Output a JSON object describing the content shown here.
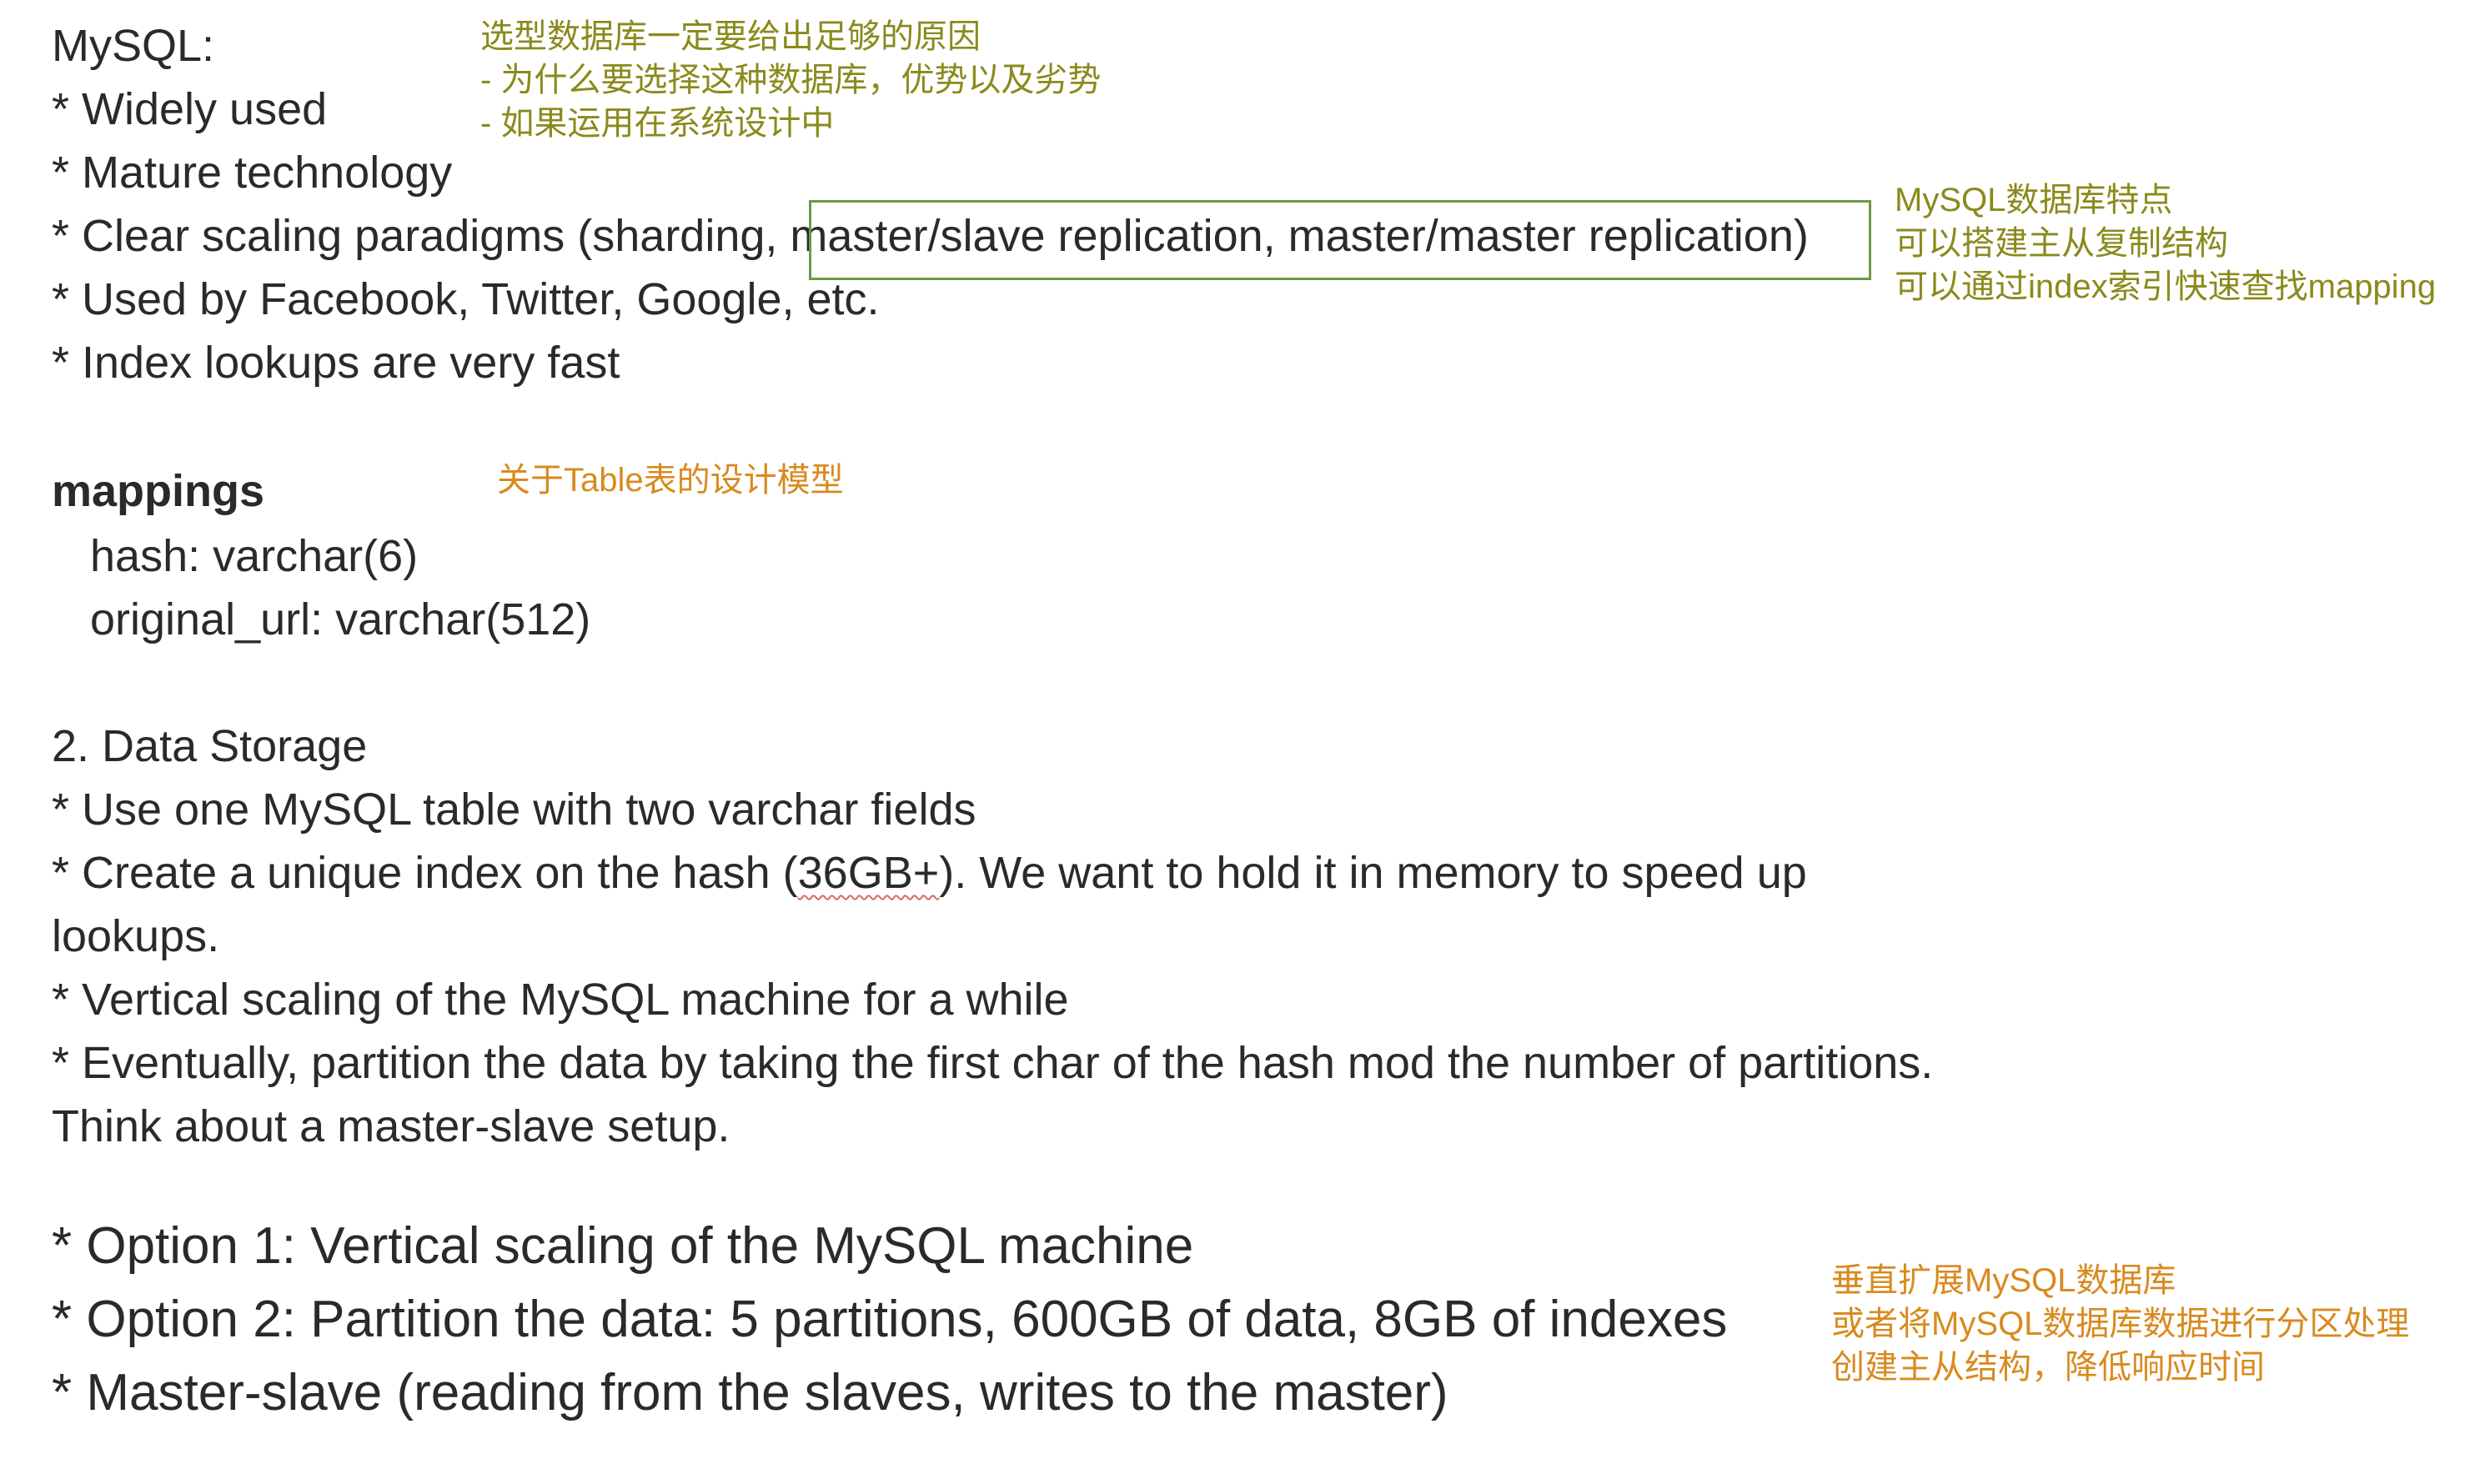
{
  "mysql": {
    "title": "MySQL:",
    "bullets": [
      "* Widely used",
      "* Mature technology",
      "* Clear scaling paradigms (sharding, ",
      "* Used by Facebook, Twitter, Google, etc.",
      "* Index lookups are very fast"
    ],
    "boxed_text": "master/slave replication, master/master replication)"
  },
  "notes": {
    "selection": [
      "选型数据库一定要给出足够的原因",
      "- 为什么要选择这种数据库，优势以及劣势",
      "- 如果运用在系统设计中"
    ],
    "mysql_features": [
      "MySQL数据库特点",
      "可以搭建主从复制结构",
      "可以通过index索引快速查找mapping"
    ],
    "table_design": "关于Table表的设计模型",
    "scaling": [
      "垂直扩展MySQL数据库",
      "或者将MySQL数据库数据进行分区处理",
      "创建主从结构，降低响应时间"
    ]
  },
  "mappings": {
    "title": "mappings",
    "fields": [
      "hash: varchar(6)",
      "original_url: varchar(512)"
    ]
  },
  "storage": {
    "title": "2. Data Storage",
    "line1": "* Use one MySQL table with two varchar fields",
    "line2_pre": "* Create a unique index on the hash (",
    "line2_mark": "36GB+",
    "line2_post": "). We want to hold it in memory to speed up",
    "line3": "lookups.",
    "line4": "* Vertical scaling of the MySQL machine for a while",
    "line5": "* Eventually, partition the data by taking the first char of the hash mod the number of partitions.",
    "line6": "Think about a master-slave setup."
  },
  "options": [
    "* Option 1: Vertical scaling of the MySQL machine",
    "* Option 2: Partition the data: 5 partitions, 600GB of data, 8GB of indexes",
    "* Master-slave (reading from the slaves, writes to the master)"
  ],
  "colors": {
    "olive_note": "#8a8a1c",
    "orange_note": "#d98a1e",
    "box_border": "#6a9a45",
    "body_text": "#2a2a2a"
  }
}
